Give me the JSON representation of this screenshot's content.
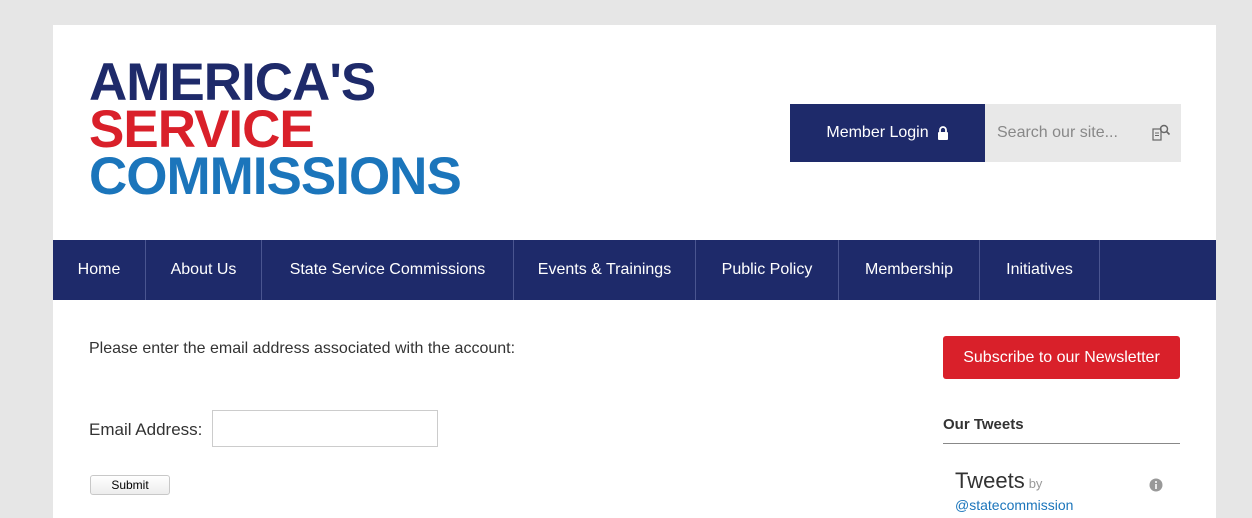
{
  "logo": {
    "line1": "AMERICA'S",
    "line2": "SERVICE",
    "line3": "COMMISSIONS"
  },
  "header": {
    "login_label": "Member Login",
    "login_icon": "lock-icon",
    "search_placeholder": "Search our site...",
    "search_icon": "search-icon"
  },
  "nav": {
    "items": [
      {
        "label": "Home"
      },
      {
        "label": "About Us"
      },
      {
        "label": "State Service Commissions"
      },
      {
        "label": "Events & Trainings"
      },
      {
        "label": "Public Policy"
      },
      {
        "label": "Membership"
      },
      {
        "label": "Initiatives"
      }
    ]
  },
  "main": {
    "prompt": "Please enter the email address associated with the account:",
    "email_label": "Email Address:",
    "email_value": "",
    "submit_label": "Submit"
  },
  "sidebar": {
    "subscribe_label": "Subscribe to our Newsletter",
    "tweets_heading": "Our Tweets",
    "tweets_title": "Tweets",
    "tweets_by": "by",
    "tweets_handle": "@statecommission"
  },
  "colors": {
    "navy": "#1e2a6a",
    "red": "#d9202a",
    "blue": "#1b75bb"
  }
}
